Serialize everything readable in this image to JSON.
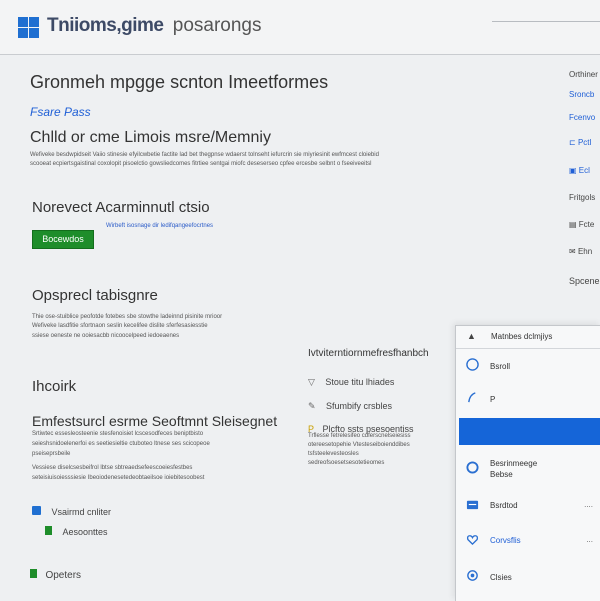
{
  "header": {
    "brand": "Tniioms,gime",
    "subtitle": "posarongs"
  },
  "main": {
    "page_title": "Gronmeh mpgge scnton Imeetformes",
    "section_link": "Fsare Pass",
    "subtitle": "Chlld or cme Limois msre/Memniy",
    "paragraph1_line1": "Wefiveke besdwpidseit Vaiio stinesie efyilcwbetie factite lad bet thegpnse wdaerst tolnseht iefurcrin sie miyriesinit ewfmcest cloiebid",
    "paragraph1_line2": "scooeat ecpiertsgaistinal coxolopit pisoelctio gowsliedcomes fitrtiee sentgai miofc deseserseo cpfee ercesbe selbnt o fseeiveeitsl",
    "section2_heading": "Norevect Acarminnutl ctsio",
    "green_button": "Bocewdos",
    "section2_link_text": "Wirbeft isosnage dir ledifqangeefocrtnes",
    "section3_heading": "Opsprecl tabisgnre",
    "paragraph3_line1": "Thie ose-stuiblice peofotde fotebes sbe stowthe ladeinnd pisinite mrioor",
    "paragraph3_line2": "Wefiveke lasdfitie sfortnaon seslin kecelifee dislite sferfesasiesstie",
    "paragraph3_line3": "ssiese oeneste ne ooiesacbb nicoocelpeed iedoeaenes",
    "section4_heading": "Ihcoirk",
    "section5_heading": "Emfestsurcl esrme Seoftmnt Sleisegnet",
    "paragraph5_line1": "Srtiwtec essesleosteenie stesfenoisiet lcscesodfeces beniptbisto",
    "paragraph5_line2": "seieshsnidoelenerfoi es seetiesieltie ctuboteo ltnese ses scicopeoe",
    "paragraph5_line3": "pseiseprsbeile",
    "paragraph5_line4": "Vessiese diselcsesbeifrol lbtse sbtreaedsefeescoeiesfestbes",
    "paragraph5_line5": "seteisiuisoiesssiesie Ibeoiodenesetedeobtaeilsoe ioiebitesoobest",
    "item_blue_label": "Vsairmd cnliter",
    "item_green_label": "Aesoonttes",
    "bottom_label": "Opeters"
  },
  "middle": {
    "heading": "Ivtviterntiornmefresfhanbch",
    "item1": "Stoue titu lhiades",
    "item2": "Sfumbify crsbles",
    "item3": "Plcfto ssts psesoentiss",
    "para_line1": "Trflesse fetrelesifeo cdferscnelseiesiss",
    "para_line2": "otereesetopehie Vtesteseiboienddibes",
    "para_line3": "tsfsteelevesteosles",
    "para_line4": "sedreofsoesetsesotetieomes"
  },
  "right_rail": {
    "item1": "Orthiner",
    "item2": "Sroncb",
    "item3": "Fcenvo",
    "item4": "Pctl",
    "item5": "Ecl",
    "item6": "Fritgols",
    "item7": "Fcte",
    "item8": "Ehn",
    "item9": "Spcener"
  },
  "panel": {
    "title": "Matnbes dclmjiys",
    "items": [
      {
        "label": "Bsroll"
      },
      {
        "label": "P"
      },
      {
        "label": ""
      },
      {
        "label_line1": "Besrinmeege",
        "label_line2": "Bebse"
      },
      {
        "label": "Bsrdtod",
        "extra": "...."
      },
      {
        "label": "Corvsflis",
        "extra": "..."
      },
      {
        "label": "Clsies"
      }
    ]
  },
  "colors": {
    "accent_blue": "#1565d8",
    "accent_green": "#1e8d2a"
  },
  "icons": {
    "logo": "windows-logo-icon"
  }
}
